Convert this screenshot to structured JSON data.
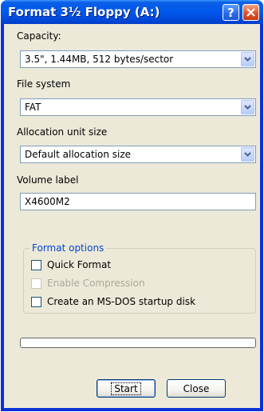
{
  "window": {
    "title": "Format 3½ Floppy (A:)",
    "help_label": "?"
  },
  "capacity": {
    "label": "Capacity:",
    "value": "3.5\",  1.44MB, 512 bytes/sector"
  },
  "file_system": {
    "label": "File system",
    "value": "FAT"
  },
  "allocation": {
    "label": "Allocation unit size",
    "value": "Default allocation size"
  },
  "volume": {
    "label": "Volume label",
    "value": "X4600M2"
  },
  "format_options": {
    "title": "Format options",
    "quick_format": {
      "label": "Quick Format",
      "checked": false,
      "enabled": true
    },
    "compression": {
      "label": "Enable Compression",
      "checked": false,
      "enabled": false
    },
    "msdos": {
      "label": "Create an MS-DOS startup disk",
      "checked": false,
      "enabled": true
    }
  },
  "progress": {
    "value": 0
  },
  "buttons": {
    "start": "Start",
    "close": "Close"
  },
  "colors": {
    "title_bar": "#0058ee",
    "client_bg": "#ece9d8",
    "group_title": "#0046d5",
    "close_btn": "#e0532a"
  },
  "icons": {
    "help": "help-icon",
    "close": "close-icon",
    "dropdown": "chevron-down-icon"
  }
}
